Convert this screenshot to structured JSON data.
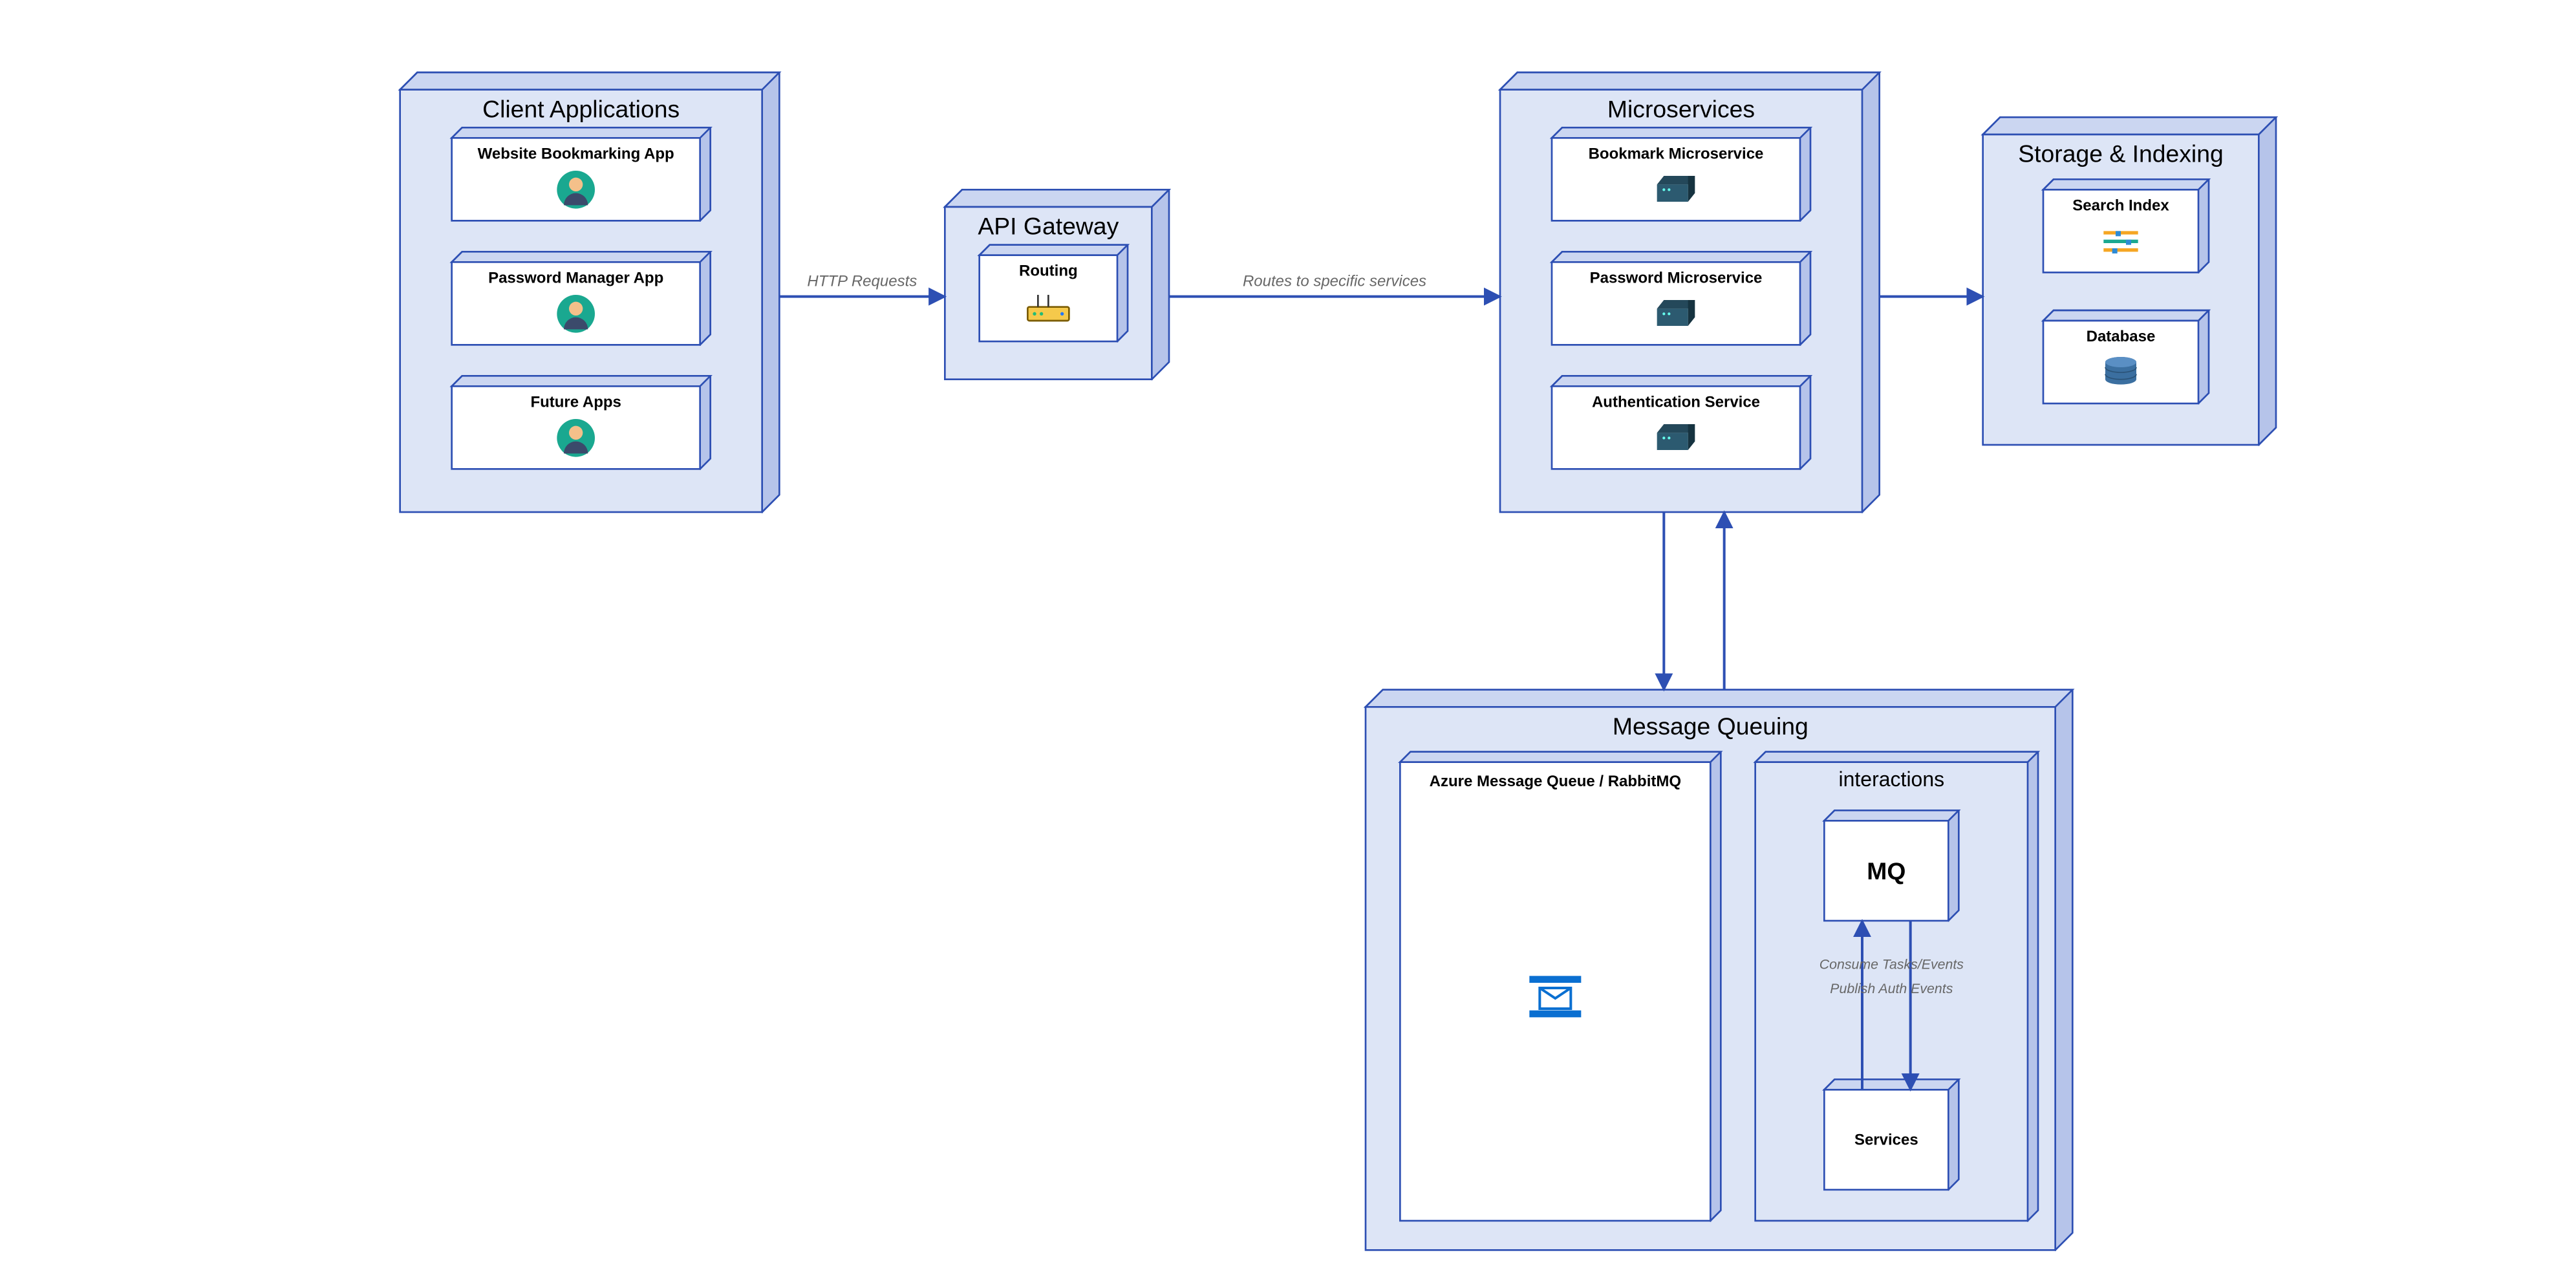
{
  "groups": {
    "clients": {
      "title": "Client Applications"
    },
    "gateway": {
      "title": "API Gateway"
    },
    "micro": {
      "title": "Microservices"
    },
    "storage": {
      "title": "Storage & Indexing"
    },
    "mq": {
      "title": "Message Queuing"
    },
    "interact": {
      "title": "interactions"
    }
  },
  "nodes": {
    "cli1": {
      "title": "Website Bookmarking App"
    },
    "cli2": {
      "title": "Password Manager App"
    },
    "cli3": {
      "title": "Future Apps"
    },
    "gw": {
      "title": "Routing"
    },
    "m1": {
      "title": "Bookmark Microservice"
    },
    "m2": {
      "title": "Password Microservice"
    },
    "m3": {
      "title": "Authentication Service"
    },
    "s1": {
      "title": "Search Index"
    },
    "s2": {
      "title": "Database"
    },
    "q1": {
      "title": "Azure Message Queue / RabbitMQ"
    },
    "q2": {
      "title": "MQ"
    },
    "q3": {
      "title": "Services"
    }
  },
  "edges": {
    "e1": {
      "label": "HTTP Requests"
    },
    "e2": {
      "label": "Routes to specific services"
    },
    "e3": {
      "label": ""
    },
    "e4": {
      "label1": "Consume Tasks/Events",
      "label2": "Publish Auth Events"
    }
  }
}
